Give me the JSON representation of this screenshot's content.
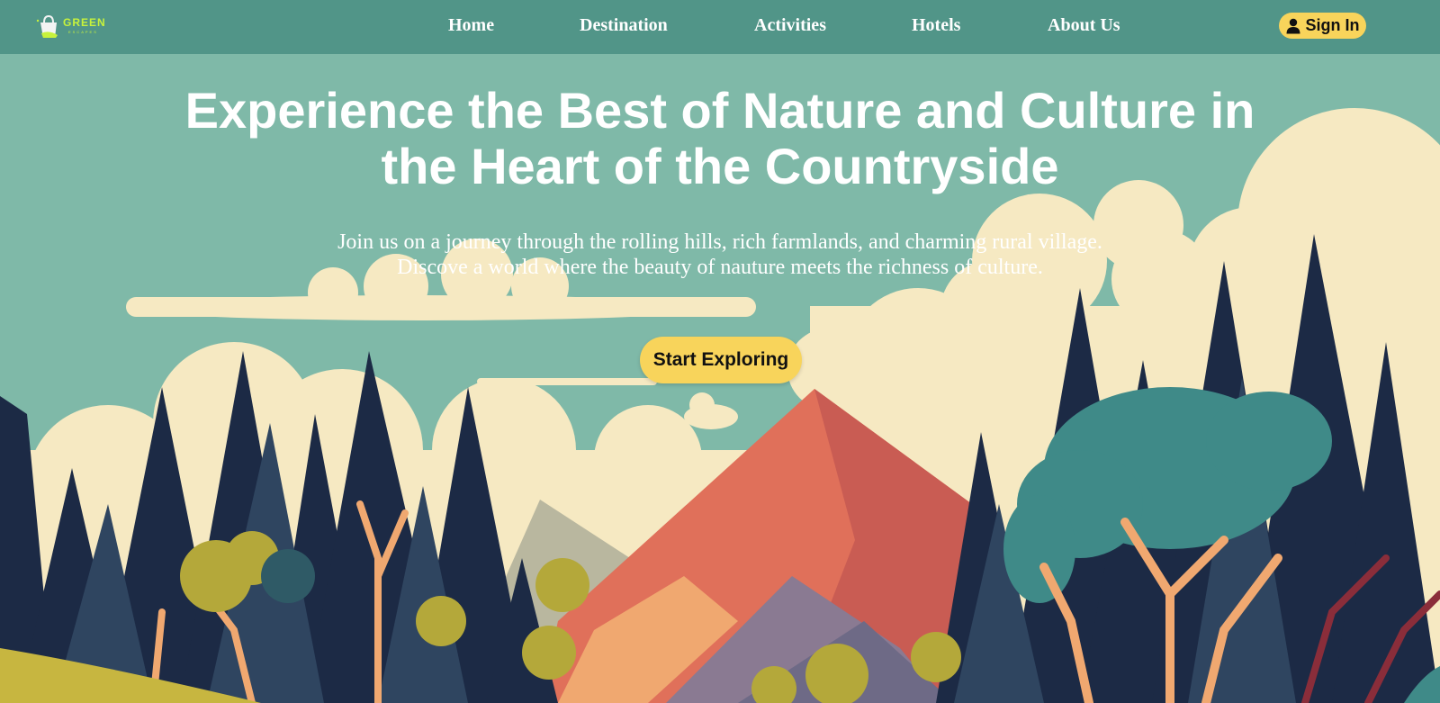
{
  "brand": {
    "name": "GREEN",
    "tagline": "ESCAPES"
  },
  "nav": {
    "items": [
      {
        "label": "Home"
      },
      {
        "label": "Destination"
      },
      {
        "label": "Activities"
      },
      {
        "label": "Hotels"
      },
      {
        "label": "About Us"
      }
    ],
    "signin_label": "Sign In",
    "signin_icon": "user-icon"
  },
  "hero": {
    "headline": "Experience the Best of Nature and Culture in the Heart of the Countryside",
    "subtext_line1": "Join us on a journey through the rolling hills, rich farmlands, and charming rural village.",
    "subtext_line2": "Discove a world where the beauty of nauture meets the richness of culture.",
    "cta_label": "Start Exploring"
  },
  "colors": {
    "navbar": "#519588",
    "sky": "#7fb9a8",
    "cloud": "#f6e9c2",
    "accent": "#f8d45b",
    "forest_dark": "#1c2a45",
    "mountain": "#e0705a",
    "logo": "#c7f23c"
  }
}
